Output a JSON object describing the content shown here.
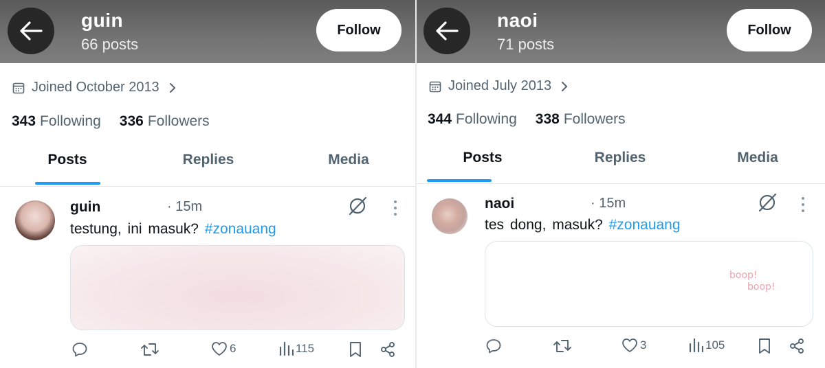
{
  "left": {
    "header": {
      "name": "guin",
      "posts": "66 posts",
      "follow_label": "Follow"
    },
    "joined": "Joined October 2013",
    "following_count": "343",
    "following_label": "Following",
    "followers_count": "336",
    "followers_label": "Followers",
    "tabs": [
      "Posts",
      "Replies",
      "Media"
    ],
    "tweet": {
      "username": "guin",
      "time": "· 15m",
      "text": "testung, ini masuk?",
      "hashtag": "#zonauang",
      "likes": "6",
      "views": "115"
    }
  },
  "right": {
    "header": {
      "name": "naoi",
      "posts": "71 posts",
      "follow_label": "Follow"
    },
    "joined": "Joined July 2013",
    "following_count": "344",
    "following_label": "Following",
    "followers_count": "338",
    "followers_label": "Followers",
    "tabs": [
      "Posts",
      "Replies",
      "Media"
    ],
    "tweet": {
      "username": "naoi",
      "time": "· 15m",
      "text": "tes dong, masuk?",
      "hashtag": "#zonauang",
      "media_text_1": "boop!",
      "media_text_2": "boop!",
      "likes": "3",
      "views": "105"
    }
  },
  "colors": {
    "accent": "#1d9bf0",
    "muted": "#536471",
    "text": "#0f1419"
  },
  "icons": [
    "back-arrow-icon",
    "calendar-icon",
    "chevron-right-icon",
    "grok-icon",
    "more-icon",
    "reply-icon",
    "retweet-icon",
    "like-icon",
    "views-icon",
    "bookmark-icon",
    "share-icon"
  ]
}
